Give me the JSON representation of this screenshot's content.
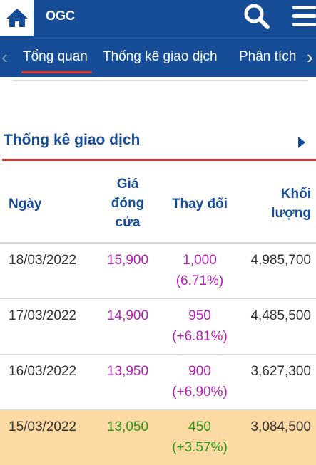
{
  "header": {
    "ticker": "OGC",
    "home_icon": "home-icon",
    "search_icon": "search-icon",
    "menu_icon": "hamburger-menu-icon",
    "bg_color": "#164d96"
  },
  "tabs": [
    {
      "label": "Tổng quan",
      "active": true
    },
    {
      "label": "Thống kê giao dịch",
      "active": false
    },
    {
      "label": "Phân tích",
      "active": false
    }
  ],
  "section": {
    "title": "Thống kê giao dịch",
    "accent_color": "#e0352b"
  },
  "table": {
    "headers": {
      "date": "Ngày",
      "close_line1": "Giá",
      "close_line2": "đóng",
      "close_line3": "cửa",
      "change": "Thay đổi",
      "vol_line1": "Khối",
      "vol_line2": "lượng"
    },
    "rows": [
      {
        "date": "18/03/2022",
        "close": "15,900",
        "change": "1,000",
        "pct": "(6.71%)",
        "volume": "4,985,700",
        "color": "purple",
        "highlight": false
      },
      {
        "date": "17/03/2022",
        "close": "14,900",
        "change": "950",
        "pct": "(+6.81%)",
        "volume": "4,485,500",
        "color": "purple",
        "highlight": false
      },
      {
        "date": "16/03/2022",
        "close": "13,950",
        "change": "900",
        "pct": "(+6.90%)",
        "volume": "3,627,300",
        "color": "purple",
        "highlight": false
      },
      {
        "date": "15/03/2022",
        "close": "13,050",
        "change": "450",
        "pct": "(+3.57%)",
        "volume": "3,084,500",
        "color": "green",
        "highlight": true
      }
    ]
  }
}
